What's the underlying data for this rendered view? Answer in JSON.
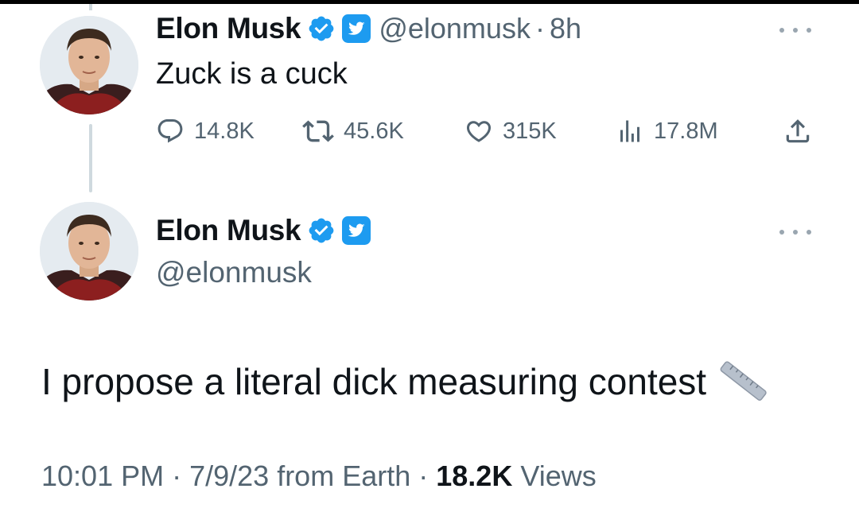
{
  "tweet1": {
    "author_name": "Elon Musk",
    "handle": "@elonmusk",
    "separator": "·",
    "time": "8h",
    "text": "Zuck is a cuck",
    "stats": {
      "replies": "14.8K",
      "retweets": "45.6K",
      "likes": "315K",
      "views": "17.8M"
    }
  },
  "tweet2": {
    "author_name": "Elon Musk",
    "handle": "@elonmusk",
    "text": "I propose a literal dick measuring contest",
    "emoji": "straight-ruler-icon",
    "meta": {
      "time": "10:01 PM",
      "sep1": " · ",
      "date": "7/9/23",
      "source": " from Earth",
      "sep2": " · ",
      "views_count": "18.2K",
      "views_label": " Views"
    }
  },
  "colors": {
    "verified_blue": "#1d9bf0",
    "text_primary": "#0f1419",
    "text_secondary": "#536471",
    "thread_line": "#cfd9de"
  }
}
